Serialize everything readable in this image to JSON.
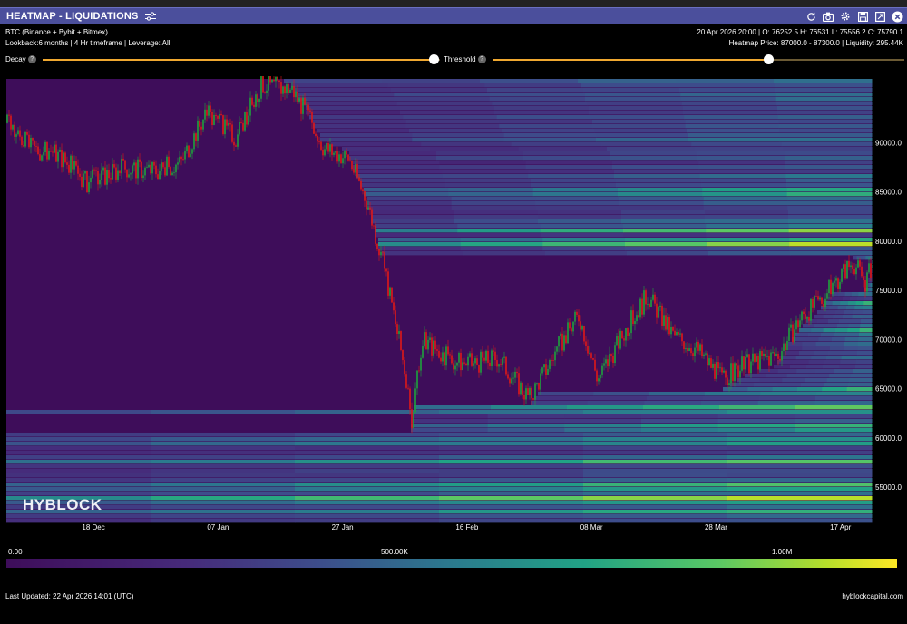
{
  "window": {
    "title": "HEATMAP - LIQUIDATIONS"
  },
  "info": {
    "symbol": "BTC (Binance + Bybit + Bitmex)",
    "params": "Lookback:6 months | 4 Hr timeframe | Leverage: All",
    "ohlc": "20 Apr 2026 20:00 | O: 76252.5 H: 76531 L: 75556.2 C: 75790.1",
    "heatmap": "Heatmap Price: 87000.0 - 87300.0 | Liquidity: 295.44K"
  },
  "controls": {
    "decay_label": "Decay",
    "threshold_label": "Threshold",
    "help_glyph": "?",
    "decay_value": 0.985,
    "threshold_value": 0.67
  },
  "colors": {
    "accent": "#f0a830",
    "titlebar": "#4b4f9c",
    "up_candle": "#1ea33c",
    "down_candle": "#e01818",
    "colorscale": [
      "#3e0d5a",
      "#462a7a",
      "#3d4d8b",
      "#2b7a8e",
      "#21a385",
      "#5ac864",
      "#b5de2b",
      "#fde725"
    ]
  },
  "icons": [
    "settings-sliders-icon",
    "refresh-icon",
    "camera-icon",
    "gear-icon",
    "save-icon",
    "expand-icon",
    "close-icon"
  ],
  "chart_data": {
    "type": "heatmap",
    "watermark": "HYBLOCK",
    "x_ticks": [
      "18 Dec",
      "07 Jan",
      "27 Jan",
      "16 Feb",
      "08 Mar",
      "28 Mar",
      "17 Apr"
    ],
    "y_ticks": [
      "90000.0",
      "85000.0",
      "80000.0",
      "75000.0",
      "70000.0",
      "65000.0",
      "60000.0",
      "55000.0"
    ],
    "y_range": [
      51500,
      96500
    ],
    "price_path": [
      {
        "date": "2025-12-04",
        "price": 92000
      },
      {
        "date": "2025-12-08",
        "price": 89500
      },
      {
        "date": "2025-12-13",
        "price": 88500
      },
      {
        "date": "2025-12-17",
        "price": 86000
      },
      {
        "date": "2025-12-23",
        "price": 87500
      },
      {
        "date": "2025-12-28",
        "price": 87200
      },
      {
        "date": "2026-01-01",
        "price": 88000
      },
      {
        "date": "2026-01-05",
        "price": 93000
      },
      {
        "date": "2026-01-10",
        "price": 90500
      },
      {
        "date": "2026-01-14",
        "price": 96000
      },
      {
        "date": "2026-01-19",
        "price": 95500
      },
      {
        "date": "2026-01-24",
        "price": 89500
      },
      {
        "date": "2026-01-28",
        "price": 88500
      },
      {
        "date": "2026-01-31",
        "price": 84000
      },
      {
        "date": "2026-02-03",
        "price": 76500
      },
      {
        "date": "2026-02-06",
        "price": 67000
      },
      {
        "date": "2026-02-07",
        "price": 61500
      },
      {
        "date": "2026-02-09",
        "price": 70000
      },
      {
        "date": "2026-02-13",
        "price": 68000
      },
      {
        "date": "2026-02-17",
        "price": 67500
      },
      {
        "date": "2026-02-21",
        "price": 68200
      },
      {
        "date": "2026-02-26",
        "price": 64000
      },
      {
        "date": "2026-03-02",
        "price": 68500
      },
      {
        "date": "2026-03-06",
        "price": 72500
      },
      {
        "date": "2026-03-09",
        "price": 66000
      },
      {
        "date": "2026-03-14",
        "price": 71500
      },
      {
        "date": "2026-03-17",
        "price": 74500
      },
      {
        "date": "2026-03-21",
        "price": 70500
      },
      {
        "date": "2026-03-25",
        "price": 69000
      },
      {
        "date": "2026-03-29",
        "price": 66000
      },
      {
        "date": "2026-04-02",
        "price": 67500
      },
      {
        "date": "2026-04-07",
        "price": 68500
      },
      {
        "date": "2026-04-11",
        "price": 72500
      },
      {
        "date": "2026-04-14",
        "price": 74000
      },
      {
        "date": "2026-04-17",
        "price": 76500
      },
      {
        "date": "2026-04-19",
        "price": 78000
      },
      {
        "date": "2026-04-21",
        "price": 75800
      },
      {
        "date": "2026-04-22",
        "price": 77500
      }
    ],
    "bright_bands": [
      {
        "price": 80000,
        "value": 0.95
      },
      {
        "price": 81300,
        "value": 0.8
      },
      {
        "price": 85200,
        "value": 0.75
      },
      {
        "price": 77700,
        "value": 0.6
      },
      {
        "price": 73800,
        "value": 0.7
      },
      {
        "price": 71200,
        "value": 0.65
      },
      {
        "price": 65000,
        "value": 0.7
      },
      {
        "price": 63200,
        "value": 0.8
      },
      {
        "price": 61300,
        "value": 0.75
      },
      {
        "price": 59800,
        "value": 0.65
      },
      {
        "price": 57800,
        "value": 0.7
      },
      {
        "price": 55300,
        "value": 0.8
      },
      {
        "price": 54000,
        "value": 0.95
      },
      {
        "price": 52700,
        "value": 0.6
      }
    ],
    "colorbar": {
      "labels": [
        "0.00",
        "500.00K",
        "1.00M"
      ]
    }
  },
  "footer": {
    "last_updated": "Last Updated: 22 Apr 2026 14:01 (UTC)",
    "site": "hyblockcapital.com"
  }
}
